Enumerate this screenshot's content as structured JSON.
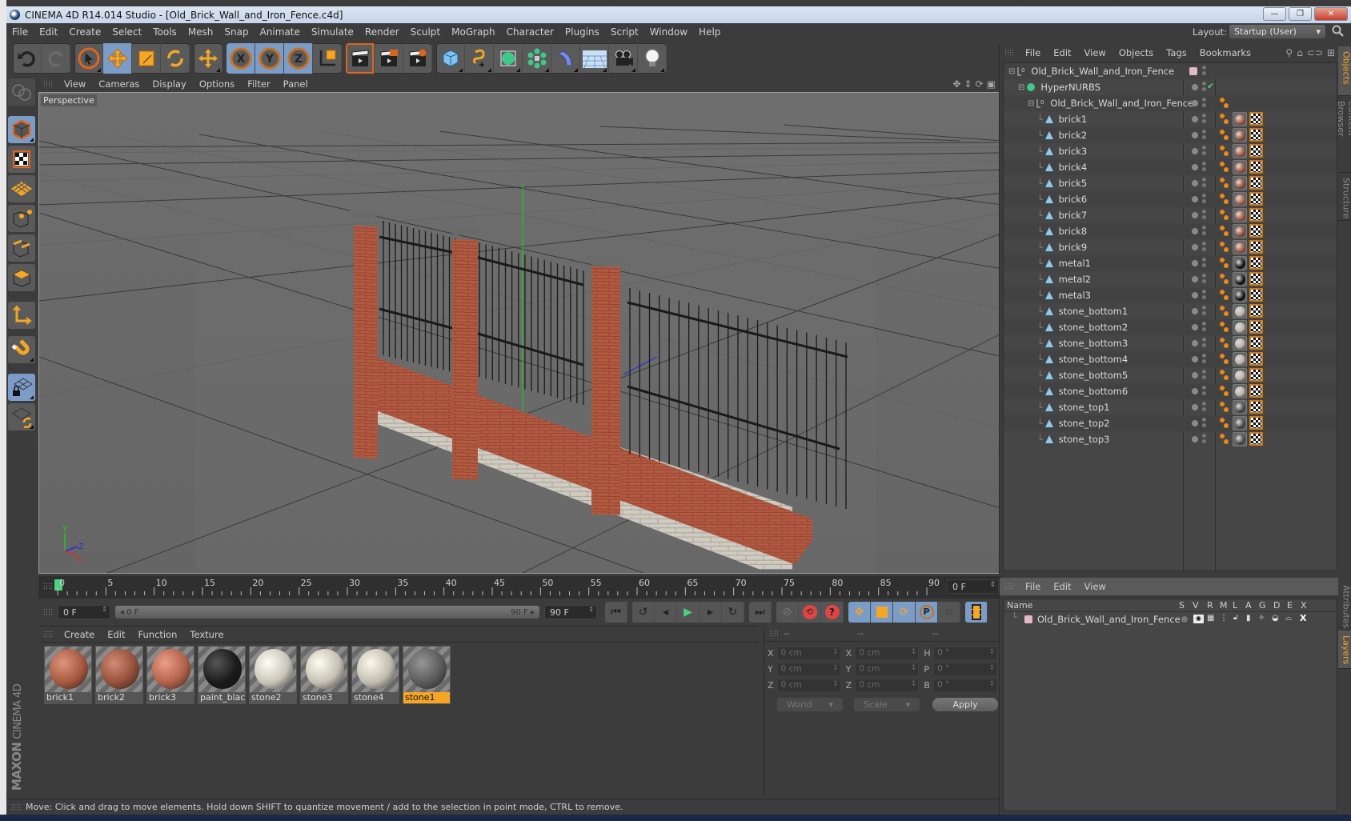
{
  "window": {
    "title": "CINEMA 4D R14.014 Studio - [Old_Brick_Wall_and_Iron_Fence.c4d]",
    "minimize_label": "—",
    "restore_label": "❐",
    "close_label": "✕"
  },
  "menubar": {
    "items": [
      "File",
      "Edit",
      "Create",
      "Select",
      "Tools",
      "Mesh",
      "Snap",
      "Animate",
      "Simulate",
      "Render",
      "Sculpt",
      "MoGraph",
      "Character",
      "Plugins",
      "Script",
      "Window",
      "Help"
    ],
    "layout_label": "Layout:",
    "layout_value": "Startup (User)"
  },
  "toolbar": {
    "groups": [
      [
        "undo-icon",
        "redo-icon"
      ],
      [
        "live-selection-icon",
        "move-icon",
        "scale-icon",
        "rotate-icon"
      ],
      [
        "recent-tool-icon"
      ],
      [
        "x-axis-lock-icon",
        "y-axis-lock-icon",
        "z-axis-lock-icon",
        "coordinate-system-icon"
      ],
      [
        "render-view-icon",
        "render-picture-viewer-icon",
        "render-settings-icon"
      ],
      [
        "cube-icon",
        "spline-pen-icon",
        "subdivision-surface-icon",
        "array-icon",
        "deformer-icon",
        "floor-icon",
        "camera-icon",
        "light-icon"
      ]
    ],
    "axis_labels": [
      "X",
      "Y",
      "Z"
    ]
  },
  "left_toolbar": {
    "items": [
      "model-mode-icon",
      "object-mode-icon",
      "texture-mode-icon",
      "workplane-mode-icon",
      "points-mode-icon",
      "edges-mode-icon",
      "polygons-mode-icon",
      "axis-mode-icon",
      "tweak-magnet-icon",
      "workplane-lock-icon",
      "workplane-rotate-icon"
    ]
  },
  "brand": {
    "maxon": "MAXON",
    "product": "CINEMA 4D"
  },
  "viewport": {
    "menu": [
      "View",
      "Cameras",
      "Display",
      "Options",
      "Filter",
      "Panel"
    ],
    "label": "Perspective",
    "axis_labels": {
      "x": "X",
      "y": "Y",
      "z": "Z"
    }
  },
  "timeline": {
    "ticks": [
      "0",
      "5",
      "10",
      "15",
      "20",
      "25",
      "30",
      "35",
      "40",
      "45",
      "50",
      "55",
      "60",
      "65",
      "70",
      "75",
      "80",
      "85",
      "90"
    ],
    "current_frame": "0 F",
    "start_field": "0 F",
    "range_start": "0 F",
    "range_end": "90 F",
    "end_field": "90 F",
    "playhead_frame": 0,
    "max_frame": 90
  },
  "transport": {
    "buttons": [
      "go-to-start-icon",
      "previous-key-icon",
      "previous-frame-icon",
      "play-icon",
      "next-frame-icon",
      "next-key-icon",
      "go-to-end-icon",
      "record-icon",
      "autokey-icon",
      "keyframe-selection-icon",
      "key-position-icon",
      "key-scale-icon",
      "key-rotation-icon",
      "key-parameter-icon",
      "key-pla-icon",
      "timeline-icon"
    ]
  },
  "material_manager": {
    "menu": [
      "Create",
      "Edit",
      "Function",
      "Texture"
    ],
    "materials": [
      {
        "name": "brick1",
        "color": "#a4583f",
        "selected": false
      },
      {
        "name": "brick2",
        "color": "#94503a",
        "selected": false
      },
      {
        "name": "brick3",
        "color": "#b0624a",
        "selected": false
      },
      {
        "name": "paint_black",
        "color": "#1a1a1a",
        "selected": false
      },
      {
        "name": "stone2",
        "color": "#c8c4b8",
        "selected": false
      },
      {
        "name": "stone3",
        "color": "#c4c0b4",
        "selected": false
      },
      {
        "name": "stone4",
        "color": "#c0bcb0",
        "selected": false
      },
      {
        "name": "stone1",
        "color": "#5a5a5a",
        "selected": true
      }
    ]
  },
  "coordinate_manager": {
    "headers": [
      "--",
      "--",
      "--"
    ],
    "rows": [
      {
        "l1": "X",
        "v1": "0 cm",
        "l2": "X",
        "v2": "0 cm",
        "l3": "H",
        "v3": "0 °"
      },
      {
        "l1": "Y",
        "v1": "0 cm",
        "l2": "Y",
        "v2": "0 cm",
        "l3": "P",
        "v3": "0 °"
      },
      {
        "l1": "Z",
        "v1": "0 cm",
        "l2": "Z",
        "v2": "0 cm",
        "l3": "B",
        "v3": "0 °"
      }
    ],
    "mode_dropdown": "World",
    "type_dropdown": "Scale",
    "apply_label": "Apply"
  },
  "status_bar": {
    "text": "Move: Click and drag to move elements. Hold down SHIFT to quantize movement / add to the selection in point mode, CTRL to remove."
  },
  "object_manager": {
    "menu": [
      "File",
      "Edit",
      "View",
      "Objects",
      "Tags",
      "Bookmarks"
    ],
    "tools": [
      "search-icon",
      "home-icon",
      "link-icon",
      "new-window-icon"
    ],
    "objects": [
      {
        "name": "Old_Brick_Wall_and_Iron_Fence",
        "type": "null",
        "depth": 0,
        "layer_color": "#e0b8c8",
        "tags": []
      },
      {
        "name": "HyperNURBS",
        "type": "hypernurbs",
        "depth": 1,
        "check": "✔",
        "tags": []
      },
      {
        "name": "Old_Brick_Wall_and_Iron_Fence",
        "type": "null",
        "depth": 2,
        "tags": [
          "phong"
        ]
      },
      {
        "name": "brick1",
        "type": "polygon",
        "depth": 3,
        "mat": "#a4583f"
      },
      {
        "name": "brick2",
        "type": "polygon",
        "depth": 3,
        "mat": "#94503a"
      },
      {
        "name": "brick3",
        "type": "polygon",
        "depth": 3,
        "mat": "#a4583f"
      },
      {
        "name": "brick4",
        "type": "polygon",
        "depth": 3,
        "mat": "#a4583f"
      },
      {
        "name": "brick5",
        "type": "polygon",
        "depth": 3,
        "mat": "#94503a"
      },
      {
        "name": "brick6",
        "type": "polygon",
        "depth": 3,
        "mat": "#b0624a"
      },
      {
        "name": "brick7",
        "type": "polygon",
        "depth": 3,
        "mat": "#a4583f"
      },
      {
        "name": "brick8",
        "type": "polygon",
        "depth": 3,
        "mat": "#94503a"
      },
      {
        "name": "brick9",
        "type": "polygon",
        "depth": 3,
        "mat": "#a4583f"
      },
      {
        "name": "metal1",
        "type": "polygon",
        "depth": 3,
        "mat": "#151515"
      },
      {
        "name": "metal2",
        "type": "polygon",
        "depth": 3,
        "mat": "#151515"
      },
      {
        "name": "metal3",
        "type": "polygon",
        "depth": 3,
        "mat": "#151515"
      },
      {
        "name": "stone_bottom1",
        "type": "polygon",
        "depth": 3,
        "mat": "#b8b4a8"
      },
      {
        "name": "stone_bottom2",
        "type": "polygon",
        "depth": 3,
        "mat": "#b8b4a8"
      },
      {
        "name": "stone_bottom3",
        "type": "polygon",
        "depth": 3,
        "mat": "#b8b4a8"
      },
      {
        "name": "stone_bottom4",
        "type": "polygon",
        "depth": 3,
        "mat": "#b8b4a8"
      },
      {
        "name": "stone_bottom5",
        "type": "polygon",
        "depth": 3,
        "mat": "#b8b4a8"
      },
      {
        "name": "stone_bottom6",
        "type": "polygon",
        "depth": 3,
        "mat": "#b8b4a8"
      },
      {
        "name": "stone_top1",
        "type": "polygon",
        "depth": 3,
        "mat": "#4a4a4a"
      },
      {
        "name": "stone_top2",
        "type": "polygon",
        "depth": 3,
        "mat": "#4a4a4a"
      },
      {
        "name": "stone_top3",
        "type": "polygon",
        "depth": 3,
        "mat": "#4a4a4a"
      }
    ]
  },
  "right_tabs": {
    "top": [
      "Objects",
      "Content Browser",
      "Structure"
    ],
    "bottom": [
      "Attributes",
      "Layers"
    ]
  },
  "layer_manager": {
    "menu": [
      "File",
      "Edit",
      "View"
    ],
    "columns": [
      "Name",
      "S",
      "V",
      "R",
      "M",
      "L",
      "A",
      "G",
      "D",
      "E",
      "X"
    ],
    "layers": [
      {
        "name": "Old_Brick_Wall_and_Iron_Fence",
        "color": "#e0b8c8"
      }
    ]
  },
  "colors": {
    "accent": "#f5a623",
    "active_button": "#7c9cc8",
    "panel_bg": "#3c3c3c",
    "playhead": "#4ad07e"
  }
}
